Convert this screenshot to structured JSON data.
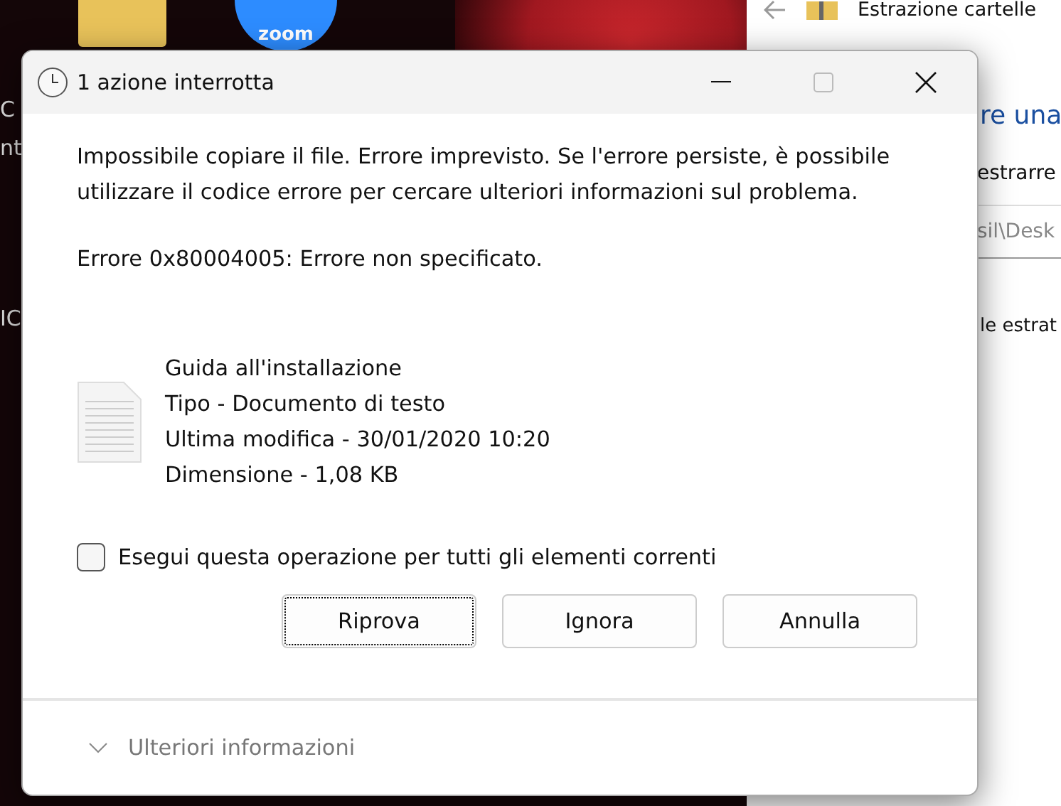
{
  "desktop": {
    "zoom_icon_label": "zoom",
    "edge_texts": [
      "C",
      "nt",
      "IC"
    ]
  },
  "explorer": {
    "title": "Estrazione cartelle",
    "heading": "re una",
    "label": "estrarre",
    "path": "sil\\Desk",
    "note": "le estrat"
  },
  "dialog": {
    "title": "1 azione interrotta",
    "message": "Impossibile copiare il file. Errore imprevisto. Se l'errore persiste, è possibile utilizzare il codice errore per cercare ulteriori informazioni sul problema.",
    "error": "Errore 0x80004005: Errore non specificato.",
    "file": {
      "name": "Guida all'installazione",
      "details": [
        "Tipo - Documento di testo",
        "Ultima modifica - 30/01/2020 10:20",
        "Dimensione - 1,08 KB"
      ]
    },
    "apply_all": {
      "label": "Esegui questa operazione per tutti gli elementi correnti",
      "checked": false
    },
    "buttons": [
      {
        "label": "Riprova",
        "focused": true
      },
      {
        "label": "Ignora",
        "focused": false
      },
      {
        "label": "Annulla",
        "focused": false
      }
    ],
    "more_info": {
      "label": "Ulteriori informazioni",
      "expanded": false
    }
  }
}
